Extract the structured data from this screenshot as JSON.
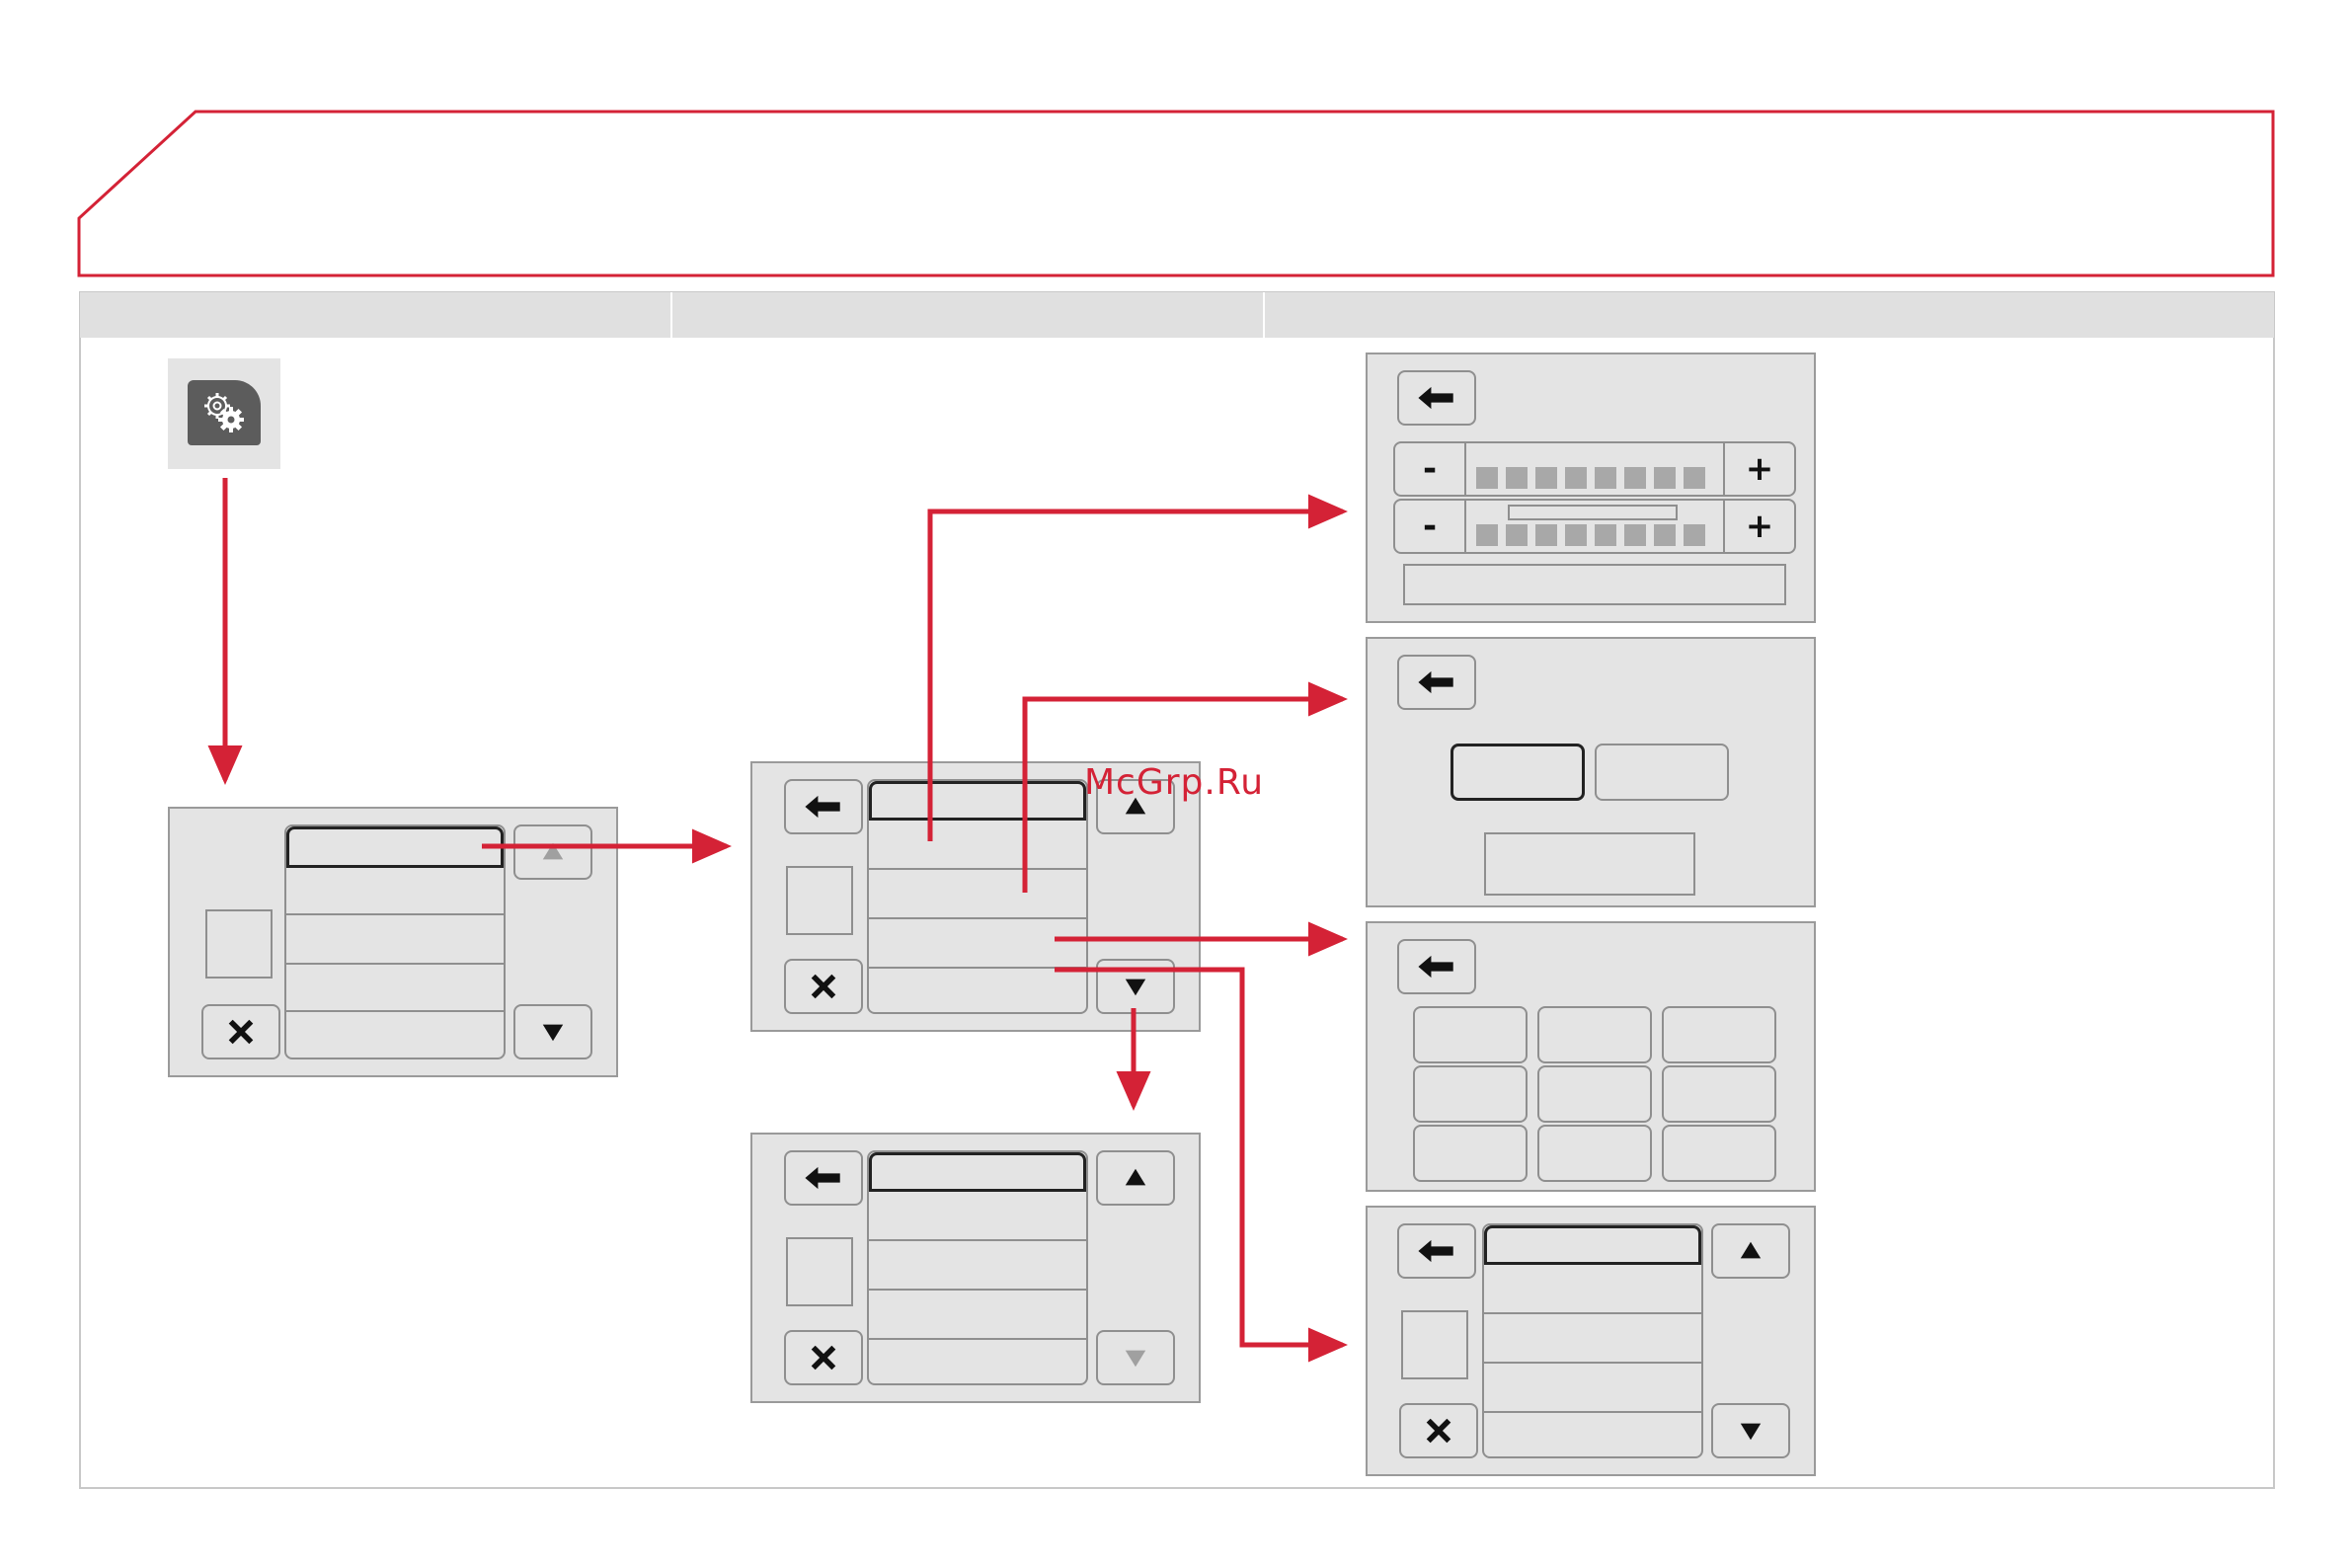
{
  "watermark": "McGrp.Ru",
  "colors": {
    "accent_red": "#d42236",
    "panel_bg": "#e4e4e4",
    "panel_border": "#9a9a9a",
    "header_bg": "#e0e0e0",
    "icon_tile_bg": "#6a6a6a"
  },
  "icons": {
    "settings": "gears-icon",
    "back": "left-arrow-icon",
    "close": "x-icon",
    "up": "triangle-up-icon",
    "down": "triangle-down-icon"
  },
  "adjust_screen": {
    "minus_label": "-",
    "plus_label": "+",
    "level_segments": 8
  }
}
